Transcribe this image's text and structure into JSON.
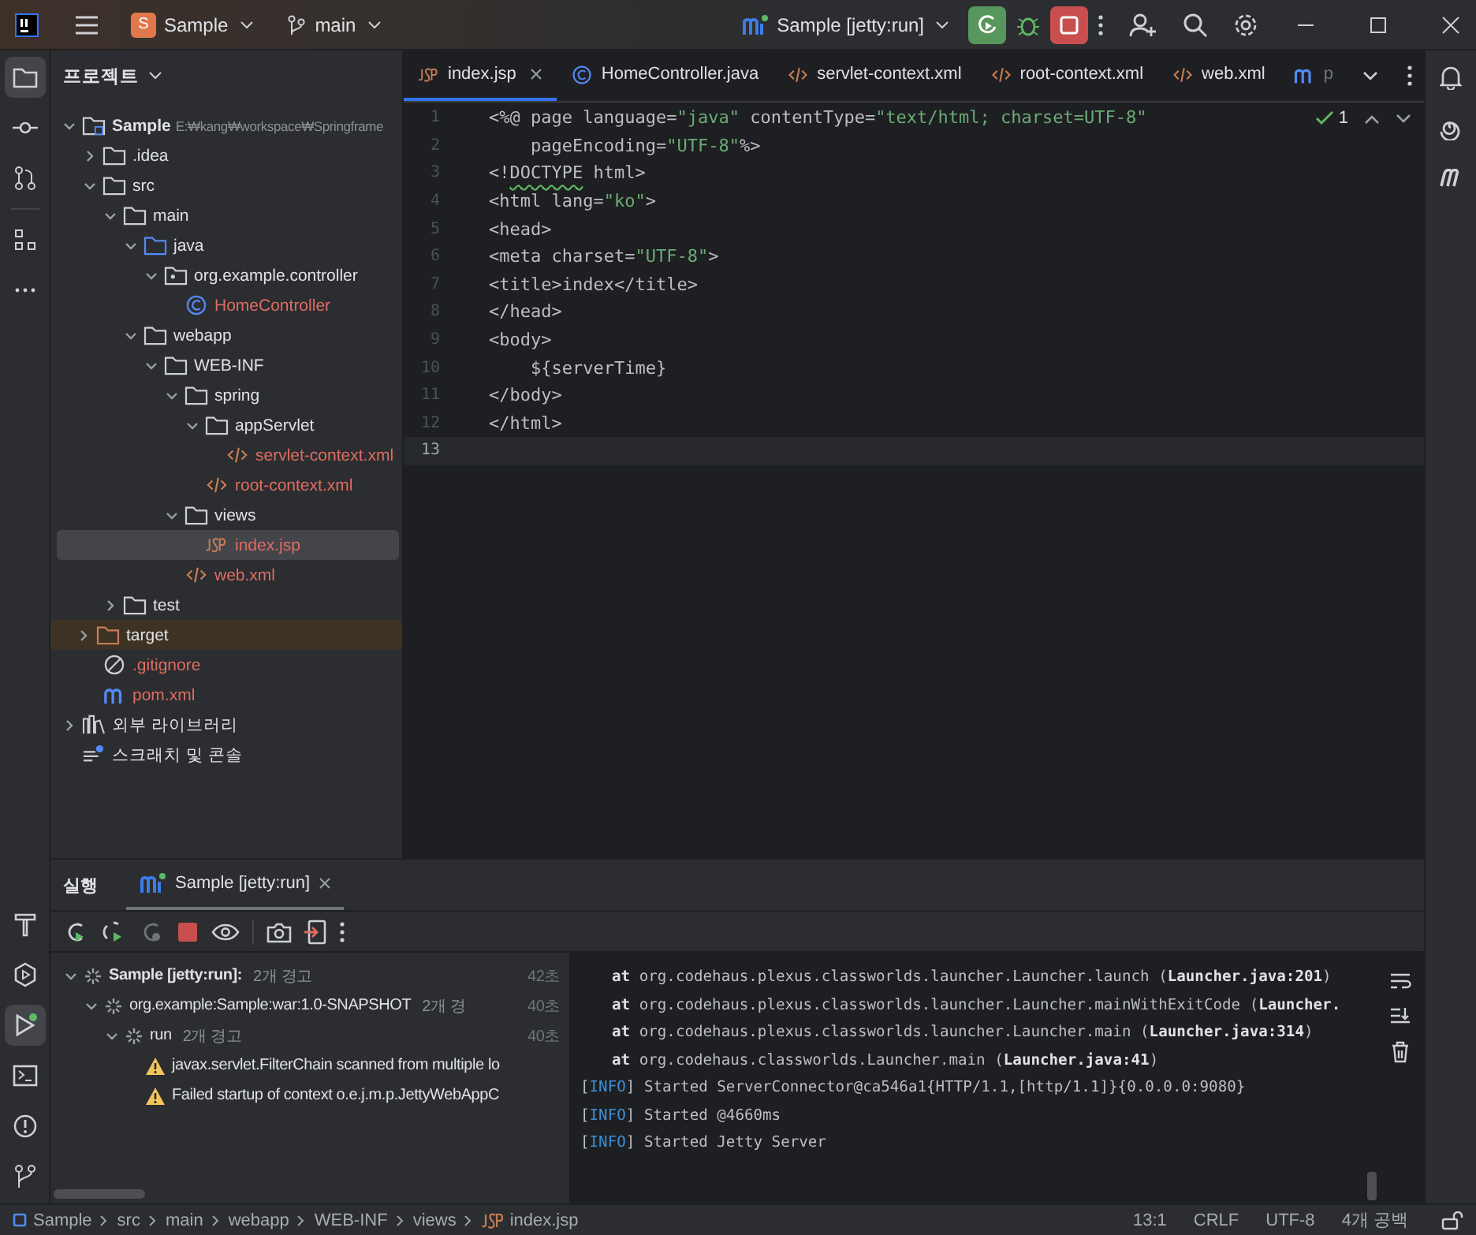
{
  "title_bar": {
    "project_initial": "S",
    "project": "Sample",
    "branch": "main",
    "run_config": "Sample [jetty:run]"
  },
  "project_panel": {
    "title": "프로젝트",
    "tree": [
      {
        "name": "Sample",
        "path": "E:₩kang₩workspace₩Springframe",
        "kind": "module",
        "expanded": true,
        "selected": false,
        "children": [
          {
            "name": ".idea",
            "kind": "folder",
            "expanded": false,
            "selected": false
          },
          {
            "name": "src",
            "kind": "folder",
            "expanded": true,
            "selected": false,
            "children": [
              {
                "name": "main",
                "kind": "folder",
                "expanded": true,
                "selected": false,
                "children": [
                  {
                    "name": "java",
                    "kind": "source",
                    "expanded": true,
                    "selected": false,
                    "children": [
                      {
                        "name": "org.example.controller",
                        "kind": "package",
                        "expanded": true,
                        "selected": false,
                        "children": [
                          {
                            "name": "HomeController",
                            "kind": "class",
                            "selected": false
                          }
                        ]
                      }
                    ]
                  },
                  {
                    "name": "webapp",
                    "kind": "folder",
                    "expanded": true,
                    "selected": false,
                    "children": [
                      {
                        "name": "WEB-INF",
                        "kind": "folder",
                        "expanded": true,
                        "selected": false,
                        "children": [
                          {
                            "name": "spring",
                            "kind": "folder",
                            "expanded": true,
                            "selected": false,
                            "children": [
                              {
                                "name": "appServlet",
                                "kind": "folder",
                                "expanded": true,
                                "selected": false,
                                "children": [
                                  {
                                    "name": "servlet-context.xml",
                                    "kind": "xml",
                                    "selected": false
                                  }
                                ]
                              },
                              {
                                "name": "root-context.xml",
                                "kind": "xml",
                                "selected": false
                              }
                            ]
                          },
                          {
                            "name": "views",
                            "kind": "folder",
                            "expanded": true,
                            "selected": false,
                            "children": [
                              {
                                "name": "index.jsp",
                                "kind": "jsp",
                                "selected": true
                              }
                            ]
                          },
                          {
                            "name": "web.xml",
                            "kind": "xml",
                            "selected": false
                          }
                        ]
                      }
                    ]
                  }
                ]
              },
              {
                "name": "test",
                "kind": "folder",
                "expanded": false,
                "selected": false
              }
            ]
          },
          {
            "name": "target",
            "kind": "excluded",
            "expanded": false,
            "selected": false
          },
          {
            "name": ".gitignore",
            "kind": "ignore",
            "selected": false
          },
          {
            "name": "pom.xml",
            "kind": "maven",
            "selected": false
          }
        ]
      },
      {
        "name": "외부 라이브러리",
        "kind": "library",
        "expanded": false,
        "selected": false
      },
      {
        "name": "스크래치 및 콘솔",
        "kind": "scratch",
        "selected": false
      }
    ]
  },
  "editor": {
    "tabs": [
      {
        "label": "index.jsp",
        "kind": "jsp",
        "selected": true,
        "closable": true
      },
      {
        "label": "HomeController.java",
        "kind": "class",
        "selected": false,
        "closable": false
      },
      {
        "label": "servlet-context.xml",
        "kind": "xml",
        "selected": false,
        "closable": false
      },
      {
        "label": "root-context.xml",
        "kind": "xml",
        "selected": false,
        "closable": false
      },
      {
        "label": "web.xml",
        "kind": "xml",
        "selected": false,
        "closable": false
      },
      {
        "label": "p",
        "kind": "maven",
        "selected": false,
        "closable": false
      }
    ],
    "inspection_count": "1",
    "lines": [
      {
        "number": "1",
        "current": false,
        "tokens": [
          {
            "text": "<%@ page language=",
            "kind": "tag"
          },
          {
            "text": "\"java\"",
            "kind": "string"
          },
          {
            "text": " contentType=",
            "kind": "tag"
          },
          {
            "text": "\"text/html; charset=UTF-8\"",
            "kind": "string"
          }
        ]
      },
      {
        "number": "2",
        "current": false,
        "tokens": [
          {
            "text": "    pageEncoding=",
            "kind": "tag"
          },
          {
            "text": "\"UTF-8\"",
            "kind": "string"
          },
          {
            "text": "%>",
            "kind": "tag"
          }
        ]
      },
      {
        "number": "3",
        "current": false,
        "tokens": [
          {
            "text": "<!",
            "kind": "tag"
          },
          {
            "text": "DOCTYPE",
            "kind": "warning"
          },
          {
            "text": " html>",
            "kind": "tag"
          }
        ]
      },
      {
        "number": "4",
        "current": false,
        "tokens": [
          {
            "text": "<html lang=",
            "kind": "tag"
          },
          {
            "text": "\"ko\"",
            "kind": "string"
          },
          {
            "text": ">",
            "kind": "tag"
          }
        ]
      },
      {
        "number": "5",
        "current": false,
        "tokens": [
          {
            "text": "<head>",
            "kind": "tag"
          }
        ]
      },
      {
        "number": "6",
        "current": false,
        "tokens": [
          {
            "text": "<meta charset=",
            "kind": "tag"
          },
          {
            "text": "\"UTF-8\"",
            "kind": "string"
          },
          {
            "text": ">",
            "kind": "tag"
          }
        ]
      },
      {
        "number": "7",
        "current": false,
        "tokens": [
          {
            "text": "<title>index</title>",
            "kind": "tag"
          }
        ]
      },
      {
        "number": "8",
        "current": false,
        "tokens": [
          {
            "text": "</head>",
            "kind": "tag"
          }
        ]
      },
      {
        "number": "9",
        "current": false,
        "tokens": [
          {
            "text": "<body>",
            "kind": "tag"
          }
        ]
      },
      {
        "number": "10",
        "current": false,
        "tokens": [
          {
            "text": "    ${serverTime}",
            "kind": "tag"
          }
        ]
      },
      {
        "number": "11",
        "current": false,
        "tokens": [
          {
            "text": "</body>",
            "kind": "tag"
          }
        ]
      },
      {
        "number": "12",
        "current": false,
        "tokens": [
          {
            "text": "</html>",
            "kind": "tag"
          }
        ]
      },
      {
        "number": "13",
        "current": true
      }
    ]
  },
  "run_panel": {
    "title": "실행",
    "tabs": [
      {
        "label": "Sample [jetty:run]",
        "selected": true
      }
    ],
    "tree": [
      {
        "label": "Sample [jetty:run]:",
        "note": "2개 경고",
        "time": "42초",
        "kind": "running",
        "expanded": true,
        "children": [
          {
            "label": "org.example:Sample:war:1.0-SNAPSHOT",
            "note": "2개 경",
            "time": "40초",
            "kind": "running",
            "expanded": true,
            "children": [
              {
                "label": "run",
                "note": "2개 경고",
                "time": "40초",
                "kind": "running",
                "expanded": true,
                "children": [
                  {
                    "label": "javax.servlet.FilterChain scanned from multiple lo",
                    "kind": "warning"
                  },
                  {
                    "label": "Failed startup of context o.e.j.m.p.JettyWebAppC",
                    "kind": "warning"
                  }
                ]
              }
            ]
          }
        ]
      }
    ],
    "console": [
      {
        "kind": "frame",
        "parts": [
          {
            "text": "at",
            "kind": "bold"
          },
          {
            "text": " org.codehaus.plexus.classworlds.launcher.Launcher.launch (",
            "kind": "plain"
          },
          {
            "text": "Launcher.java:201",
            "kind": "bold"
          },
          {
            "text": ")",
            "kind": "plain"
          }
        ]
      },
      {
        "kind": "frame",
        "parts": [
          {
            "text": "at",
            "kind": "bold"
          },
          {
            "text": " org.codehaus.plexus.classworlds.launcher.Launcher.mainWithExitCode (",
            "kind": "plain"
          },
          {
            "text": "Launcher.",
            "kind": "bold"
          }
        ]
      },
      {
        "kind": "frame",
        "parts": [
          {
            "text": "at",
            "kind": "bold"
          },
          {
            "text": " org.codehaus.plexus.classworlds.launcher.Launcher.main (",
            "kind": "plain"
          },
          {
            "text": "Launcher.java:314",
            "kind": "bold"
          },
          {
            "text": ")",
            "kind": "plain"
          }
        ]
      },
      {
        "kind": "frame",
        "parts": [
          {
            "text": "at",
            "kind": "bold"
          },
          {
            "text": " org.codehaus.classworlds.Launcher.main (",
            "kind": "plain"
          },
          {
            "text": "Launcher.java:41",
            "kind": "bold"
          },
          {
            "text": ")",
            "kind": "plain"
          }
        ]
      },
      {
        "kind": "log",
        "parts": [
          {
            "text": "[",
            "kind": "plain"
          },
          {
            "text": "INFO",
            "kind": "level"
          },
          {
            "text": "] Started ServerConnector@ca546a1{HTTP/1.1,[http/1.1]}{0.0.0.0:9080}",
            "kind": "plain"
          }
        ]
      },
      {
        "kind": "log",
        "parts": [
          {
            "text": "[",
            "kind": "plain"
          },
          {
            "text": "INFO",
            "kind": "level"
          },
          {
            "text": "] Started @4660ms",
            "kind": "plain"
          }
        ]
      },
      {
        "kind": "log",
        "parts": [
          {
            "text": "[",
            "kind": "plain"
          },
          {
            "text": "INFO",
            "kind": "level"
          },
          {
            "text": "] Started Jetty Server",
            "kind": "plain"
          }
        ]
      }
    ]
  },
  "status_bar": {
    "breadcrumbs": [
      {
        "label": "Sample",
        "kind": "module"
      },
      {
        "label": "src",
        "kind": "folder"
      },
      {
        "label": "main",
        "kind": "folder"
      },
      {
        "label": "webapp",
        "kind": "folder"
      },
      {
        "label": "WEB-INF",
        "kind": "folder"
      },
      {
        "label": "views",
        "kind": "folder"
      },
      {
        "label": "index.jsp",
        "kind": "jsp"
      }
    ],
    "position": "13:1",
    "line_separator": "CRLF",
    "encoding": "UTF-8",
    "indent": "4개 공백"
  }
}
